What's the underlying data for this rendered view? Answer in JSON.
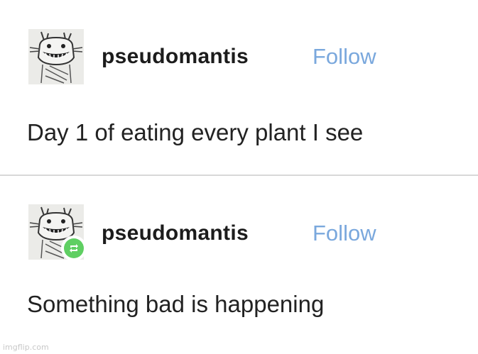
{
  "posts": [
    {
      "username": "pseudomantis",
      "follow_label": "Follow",
      "text": "Day 1 of eating every plant I see",
      "avatar_icon": "doodle-creature-avatar",
      "reblogged": false
    },
    {
      "username": "pseudomantis",
      "follow_label": "Follow",
      "text": "Something bad is happening",
      "avatar_icon": "doodle-creature-avatar",
      "reblogged": true,
      "reblog_icon": "reblog-icon"
    }
  ],
  "colors": {
    "follow": "#7aa8dd",
    "reblog_badge": "#5fcf62",
    "divider": "#d8d8d8"
  },
  "watermark": "imgflip.com"
}
